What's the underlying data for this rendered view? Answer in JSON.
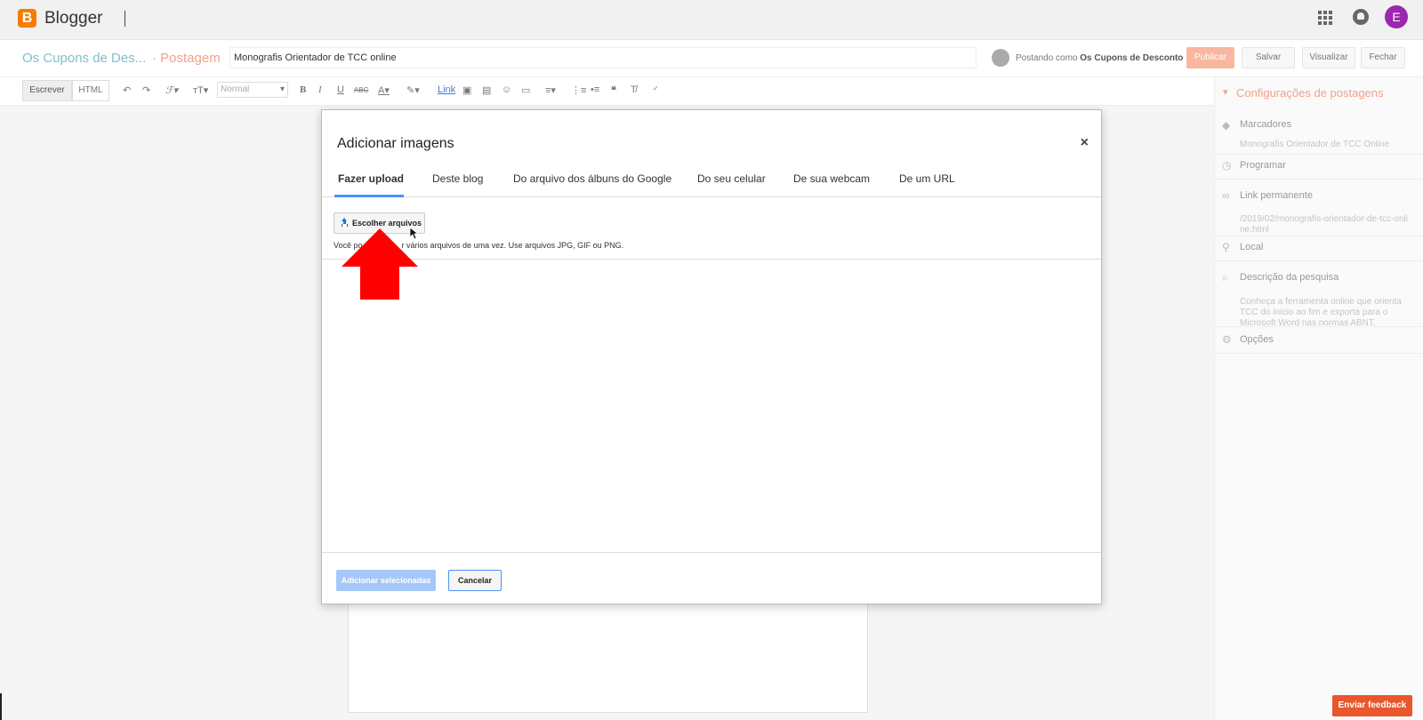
{
  "app": {
    "brand": "Blogger",
    "user_initial": "E"
  },
  "post": {
    "blog_title": "Os Cupons de Des...",
    "crumb": "· Postagem",
    "title_value": "Monografis Orientador de TCC online",
    "posting_as_label": "Postando como",
    "posting_as_name": "Os Cupons de Desconto",
    "publish": "Publicar",
    "save": "Salvar",
    "preview": "Visualizar",
    "close": "Fechar"
  },
  "toolbar": {
    "write": "Escrever",
    "html": "HTML",
    "font_size": "Normal",
    "link": "Link"
  },
  "sidebar": {
    "header": "Configurações de postagens",
    "labels": "Marcadores",
    "labels_value": "Monografis Orientador de TCC Online",
    "schedule": "Programar",
    "permalink": "Link permanente",
    "permalink_value": "/2019/02/monografis-orientador-de-tcc-online.html",
    "location": "Local",
    "search_desc": "Descrição da pesquisa",
    "search_desc_value": "Conheça a ferramenta online que orienta TCC do início ao fim e exporta para o Microsoft Word nas normas ABNT.",
    "options": "Opções"
  },
  "modal": {
    "title": "Adicionar imagens",
    "close": "×",
    "tabs": [
      "Fazer upload",
      "Deste blog",
      "Do arquivo dos álbuns do Google",
      "Do seu celular",
      "De sua webcam",
      "De um URL"
    ],
    "choose_files": "Escolher arquivos",
    "hint_prefix": "Você po",
    "hint_suffix": "r vários arquivos de uma vez. Use arquivos JPG, GIF ou PNG.",
    "add_selected": "Adicionar selecionadas",
    "cancel": "Cancelar"
  },
  "feedback": "Enviar feedback",
  "colors": {
    "blogger_orange": "#f57d00",
    "accent_salmon": "#f4a08a",
    "tab_active_underline": "#4d90fe",
    "annotation_arrow": "#ff0000",
    "feedback_button": "#e8572d"
  }
}
